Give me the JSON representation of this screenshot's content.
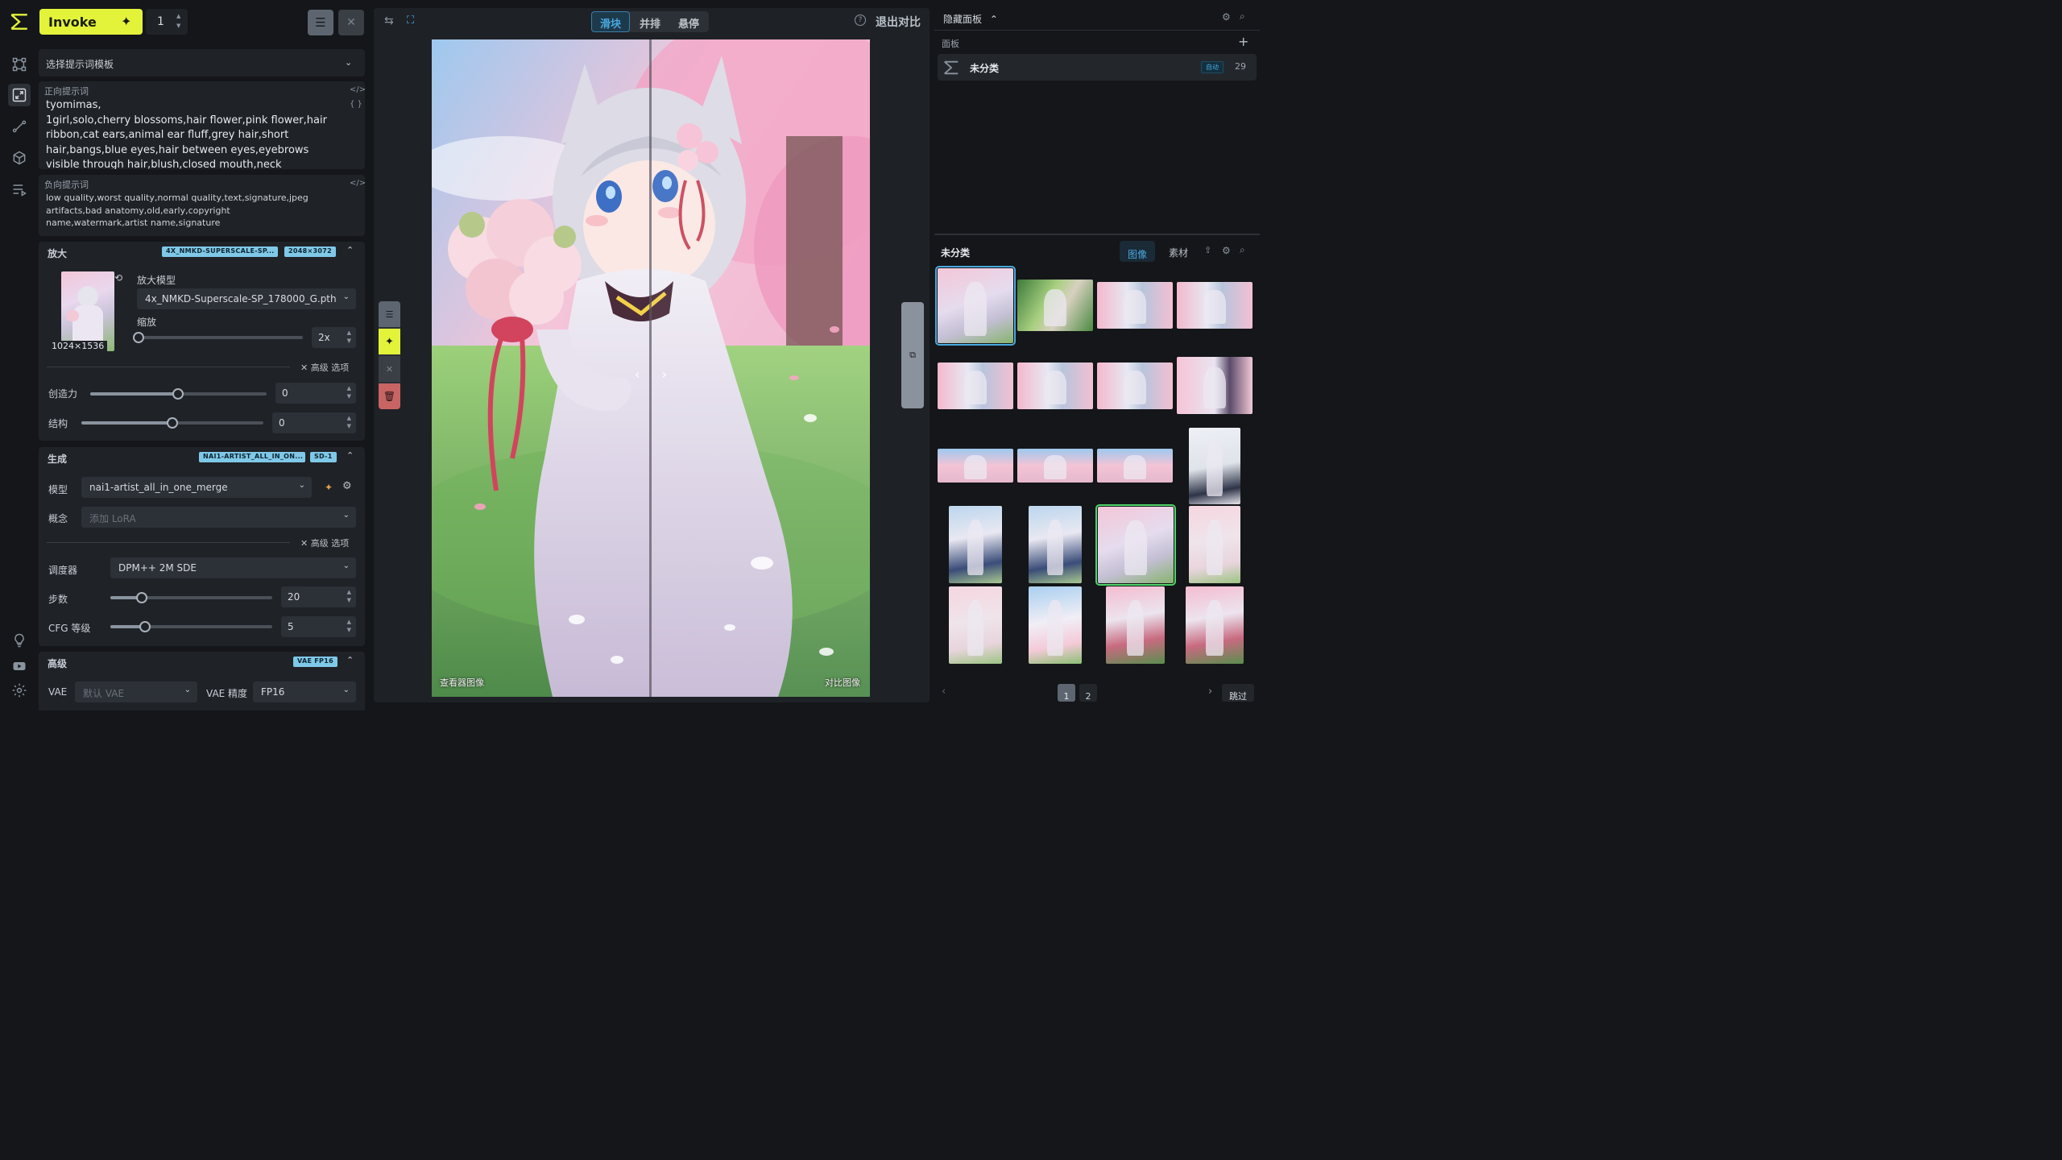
{
  "header": {
    "invoke_label": "Invoke",
    "queue_count": "1"
  },
  "prompts": {
    "template_select": "选择提示词模板",
    "positive_label": "正向提示词",
    "positive_text": "tyomimas,\n1girl,solo,cherry blossoms,hair flower,pink flower,hair ribbon,cat ears,animal ear fluff,grey hair,short hair,bangs,blue eyes,hair between eyes,eyebrows visible through hair,blush,closed mouth,neck ribbon,white",
    "negative_label": "负向提示词",
    "negative_text": "low quality,worst quality,normal quality,text,signature,jpeg artifacts,bad anatomy,old,early,copyright name,watermark,artist name,signature"
  },
  "upscale": {
    "title": "放大",
    "badge_model": "4X_NMKD-SUPERSCALE-SP...",
    "badge_size": "2048×3072",
    "image_size": "1024×1536",
    "model_label": "放大模型",
    "model_value": "4x_NMKD-Superscale-SP_178000_G.pth",
    "scale_label": "缩放",
    "scale_value": "2x",
    "advanced": "高级 选项",
    "creativity_label": "创造力",
    "creativity_value": "0",
    "creativity_level": 0.5,
    "structure_label": "结构",
    "structure_value": "0",
    "structure_level": 0.5
  },
  "generation": {
    "title": "生成",
    "badge_model": "NAI1-ARTIST_ALL_IN_ON...",
    "badge_base": "SD-1",
    "model_label": "模型",
    "model_value": "nai1-artist_all_in_one_merge",
    "concept_label": "概念",
    "concept_placeholder": "添加 LoRA",
    "advanced": "高级 选项",
    "scheduler_label": "调度器",
    "scheduler_value": "DPM++ 2M SDE",
    "steps_label": "步数",
    "steps_value": "20",
    "cfg_label": "CFG 等级",
    "cfg_value": "5"
  },
  "advanced": {
    "title": "高级",
    "badge": "VAE FP16",
    "vae_label": "VAE",
    "vae_placeholder": "默认 VAE",
    "vae_precision_label": "VAE 精度",
    "vae_precision_value": "FP16"
  },
  "viewer": {
    "tab_slider": "滑块",
    "tab_side": "并排",
    "tab_hover": "悬停",
    "exit_compare": "退出对比",
    "label_viewer": "查看器图像",
    "label_compare": "对比图像"
  },
  "boards": {
    "hide_panel": "隐藏面板",
    "boards_label": "面板",
    "board_name": "未分类",
    "board_auto": "自动",
    "board_count": "29"
  },
  "gallery": {
    "title": "未分类",
    "tab_images": "图像",
    "tab_assets": "素材",
    "pages": [
      "1",
      "2"
    ],
    "jump": "跳过"
  },
  "colors": {
    "accent_yellow": "#e3f33a",
    "accent_blue": "#4aa8e0",
    "selected_green": "#4fd36a",
    "danger": "#c86464"
  }
}
